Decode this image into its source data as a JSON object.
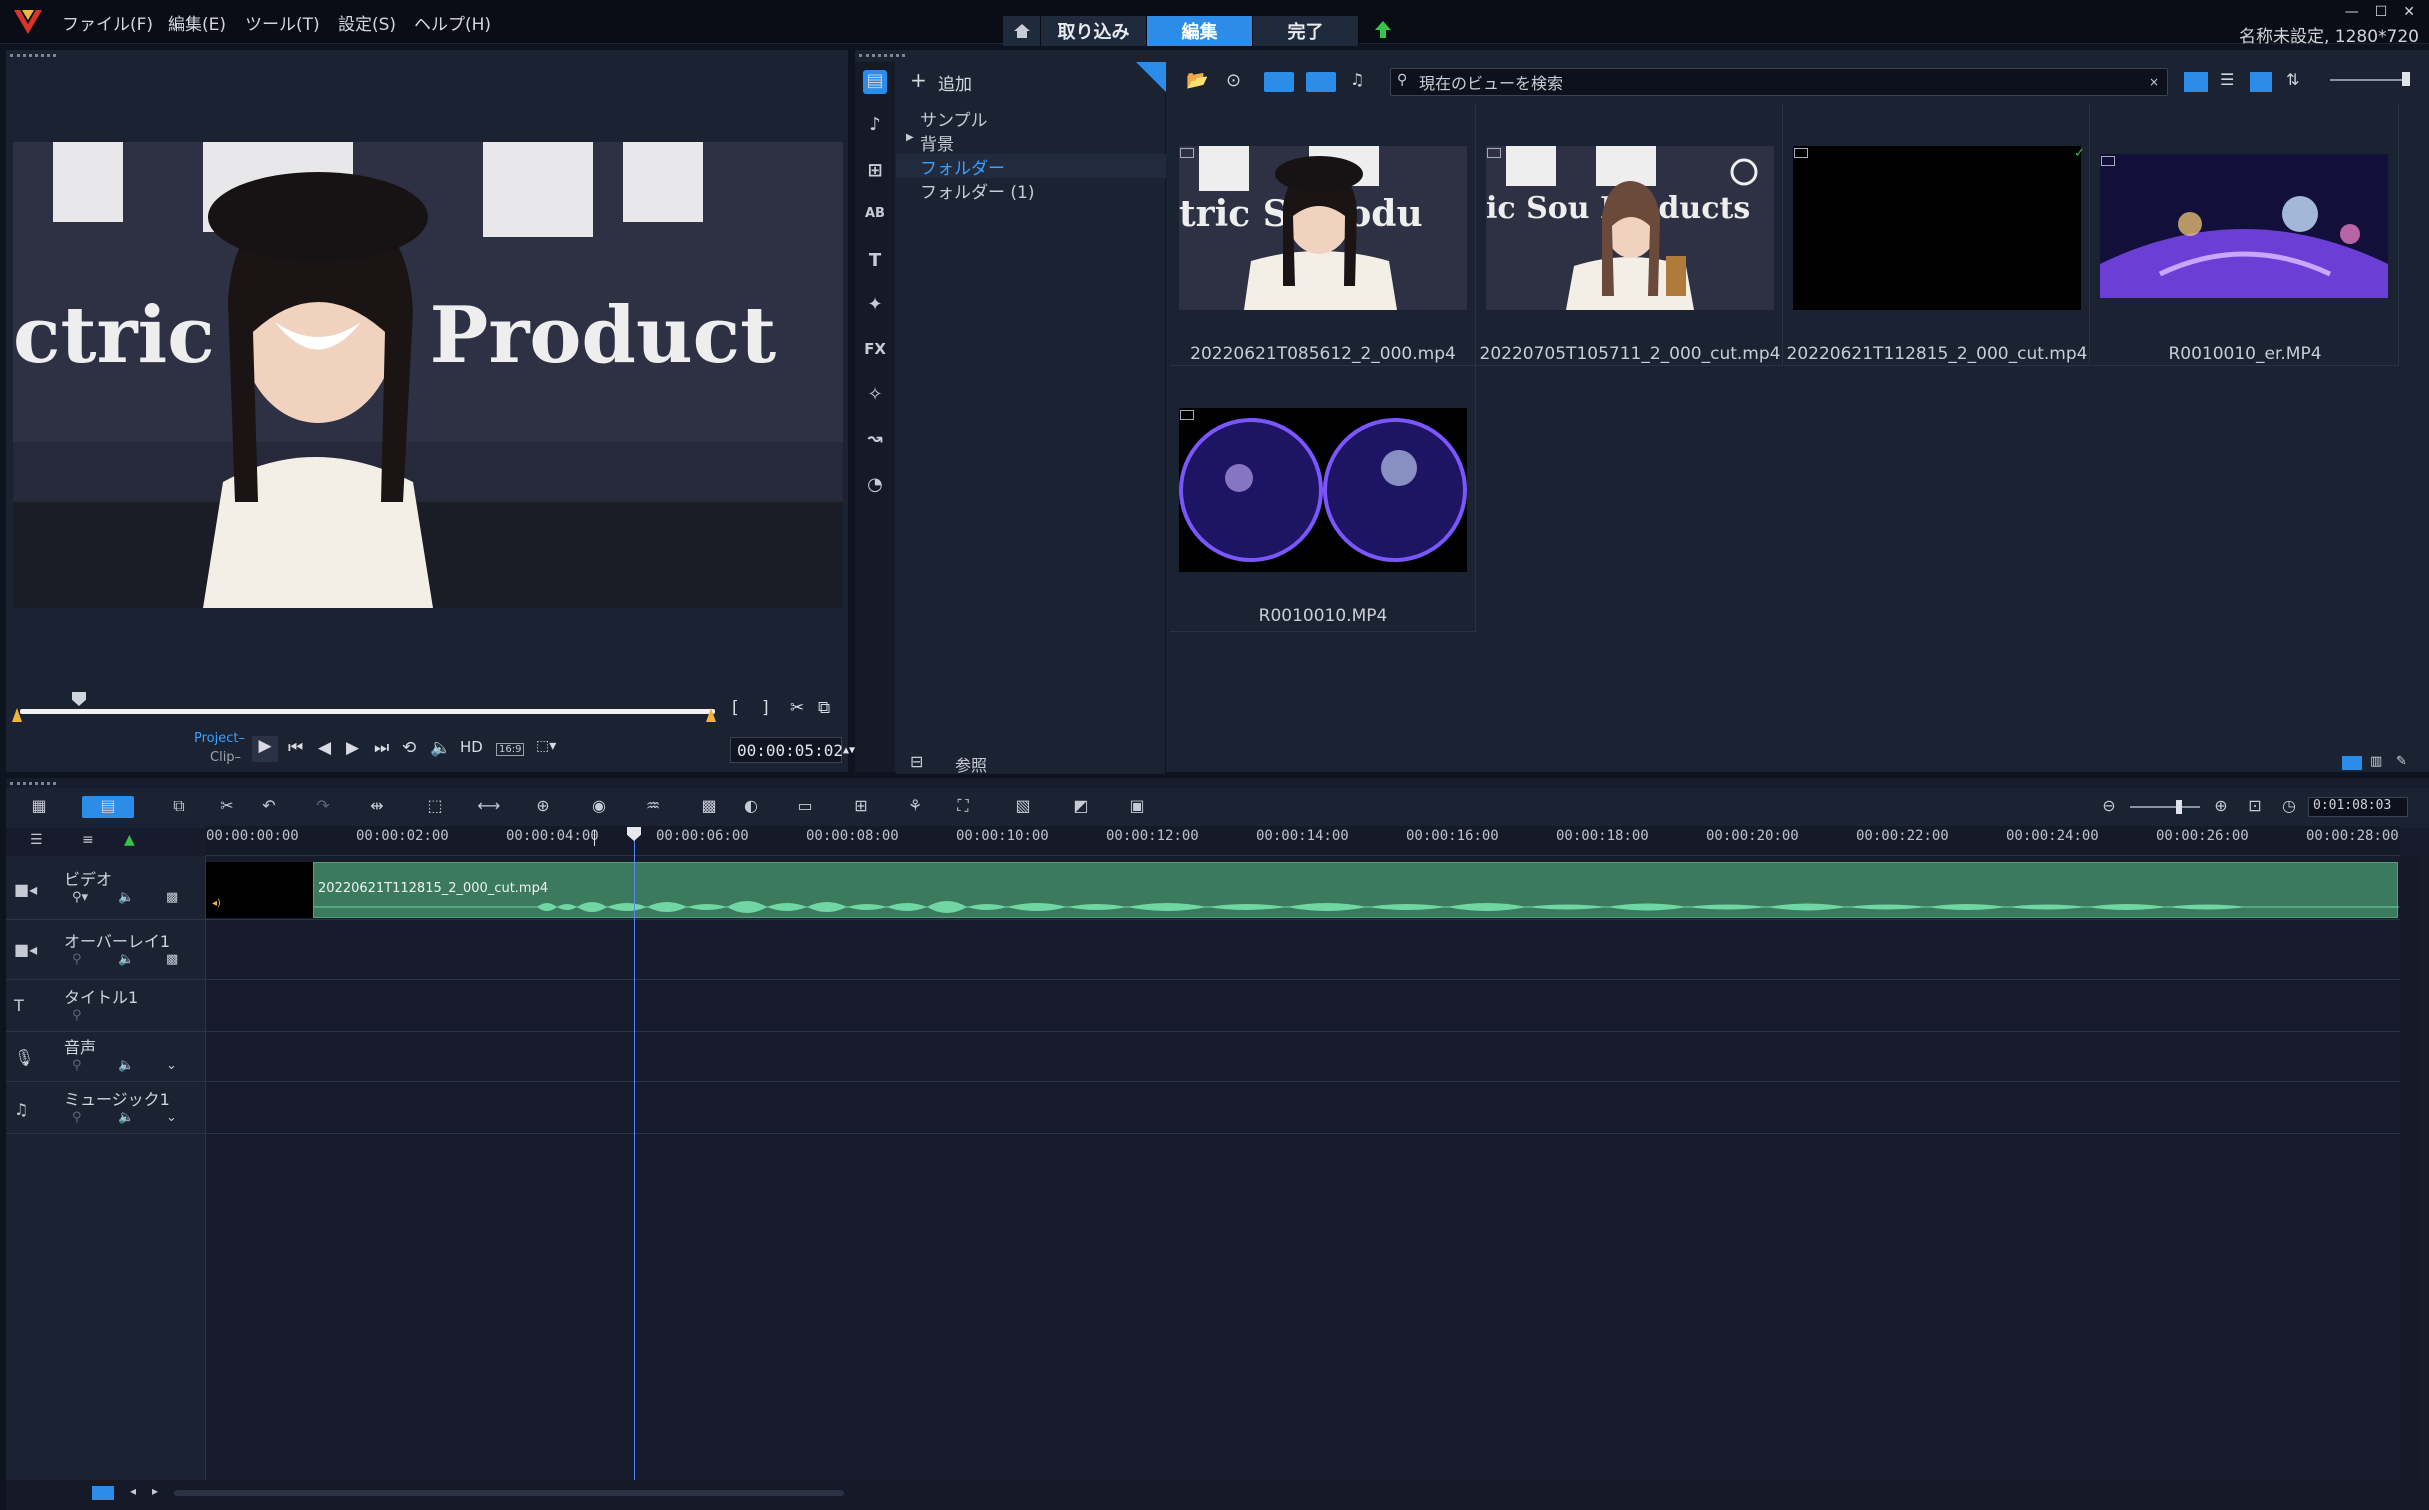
{
  "app": {
    "menu": [
      "ファイル(F)",
      "編集(E)",
      "ツール(T)",
      "設定(S)",
      "ヘルプ(H)"
    ],
    "tabs": {
      "capture": "取り込み",
      "edit": "編集",
      "share": "完了"
    },
    "project_info": "名称未設定, 1280*720",
    "colors": {
      "accent": "#2b8de8",
      "clip": "#3b7a5d",
      "waveform": "#6fd6a4",
      "playhead": "#5a85ff"
    }
  },
  "player": {
    "mode_project": "Project–",
    "mode_clip": "Clip–",
    "hd_label": "HD",
    "aspect_label": "16:9",
    "timecode": "00:00:05:02",
    "bracket_in": "[",
    "bracket_out": "]",
    "progress_fraction": 0.07
  },
  "library": {
    "add_label": "追加",
    "tree": [
      "サンプル",
      "背景",
      "フォルダー",
      "フォルダー (1)"
    ],
    "selected_folder": "フォルダー",
    "browse_label": "参照",
    "search_placeholder": "現在のビューを検索",
    "search_clear": "×",
    "fx_label": "FX",
    "thumbnails": [
      {
        "label": "20220621T085612_2_000.mp4"
      },
      {
        "label": "20220705T105711_2_000_cut.mp4"
      },
      {
        "label": "20220621T112815_2_000_cut.mp4"
      },
      {
        "label": "R0010010_er.MP4"
      },
      {
        "label": "R0010010.MP4"
      }
    ]
  },
  "timeline": {
    "zoom_timecode": "0:01:08:03",
    "ruler": [
      "00:00:00:00",
      "00:00:02:00",
      "00:00:04:00",
      "00:00:06:00",
      "00:00:08:00",
      "00:00:10:00",
      "00:00:12:00",
      "00:00:14:00",
      "00:00:16:00",
      "00:00:18:00",
      "00:00:20:00",
      "00:00:22:00",
      "00:00:24:00",
      "00:00:26:00",
      "00:00:28:00"
    ],
    "tracks": [
      "ビデオ",
      "オーバーレイ1",
      "タイトル1",
      "音声",
      "ミュージック1"
    ],
    "clip_name": "20220621T112815_2_000_cut.mp4"
  }
}
